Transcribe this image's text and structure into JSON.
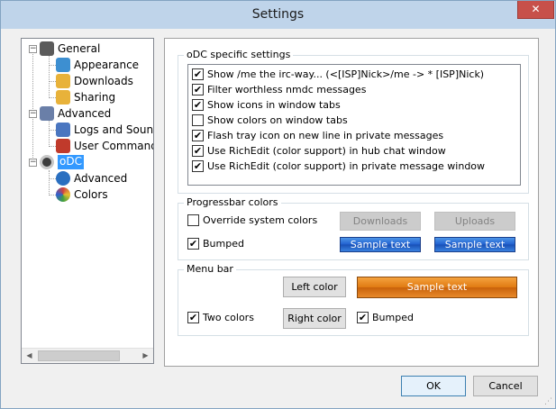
{
  "window": {
    "title": "Settings",
    "close_glyph": "✕"
  },
  "tree": {
    "items": [
      {
        "label": "General",
        "icon": "gear-icon",
        "color": "#5b5b5b",
        "expander": "−"
      },
      {
        "label": "Appearance",
        "icon": "palette-icon",
        "color": "#3d8fd1"
      },
      {
        "label": "Downloads",
        "icon": "download-folder-icon",
        "color": "#e8b23a"
      },
      {
        "label": "Sharing",
        "icon": "shared-folder-icon",
        "color": "#e8b23a"
      },
      {
        "label": "Advanced",
        "icon": "advanced-icon",
        "color": "#6a7fa8",
        "expander": "−"
      },
      {
        "label": "Logs and Sounds",
        "icon": "log-icon",
        "color": "#4a76c0"
      },
      {
        "label": "User Commands",
        "icon": "tools-icon",
        "color": "#c03a2b"
      },
      {
        "label": "oDC",
        "icon": "odc-eye-icon",
        "color": "#3d3d3d",
        "expander": "−"
      },
      {
        "label": "Advanced",
        "icon": "gear-blue-icon",
        "color": "#2a6fc0"
      },
      {
        "label": "Colors",
        "icon": "colors-icon",
        "color": "#d04040"
      }
    ],
    "scroll_left": "◀",
    "scroll_right": "▶"
  },
  "odc_settings": {
    "title": "oDC specific settings",
    "options": [
      {
        "label": "Show /me the irc-way... (<[ISP]Nick>/me -> * [ISP]Nick)",
        "checked": true
      },
      {
        "label": "Filter worthless nmdc messages",
        "checked": true
      },
      {
        "label": "Show icons in window tabs",
        "checked": true
      },
      {
        "label": "Show colors on window tabs",
        "checked": false
      },
      {
        "label": "Flash tray icon on new line in private messages",
        "checked": true
      },
      {
        "label": "Use RichEdit (color support) in hub chat window",
        "checked": true
      },
      {
        "label": "Use RichEdit (color support) in private message window",
        "checked": true
      }
    ]
  },
  "progressbar": {
    "title": "Progressbar colors",
    "override_label": "Override system colors",
    "override_checked": false,
    "downloads_label": "Downloads",
    "uploads_label": "Uploads",
    "bumped_label": "Bumped",
    "bumped_checked": true,
    "sample1": "Sample text",
    "sample2": "Sample text"
  },
  "menubar": {
    "title": "Menu bar",
    "left_color_label": "Left color",
    "sample": "Sample text",
    "two_colors_label": "Two colors",
    "two_colors_checked": true,
    "right_color_label": "Right color",
    "bumped_label": "Bumped",
    "bumped_checked": true
  },
  "footer": {
    "ok_label": "OK",
    "cancel_label": "Cancel"
  },
  "check_glyph": "✔"
}
